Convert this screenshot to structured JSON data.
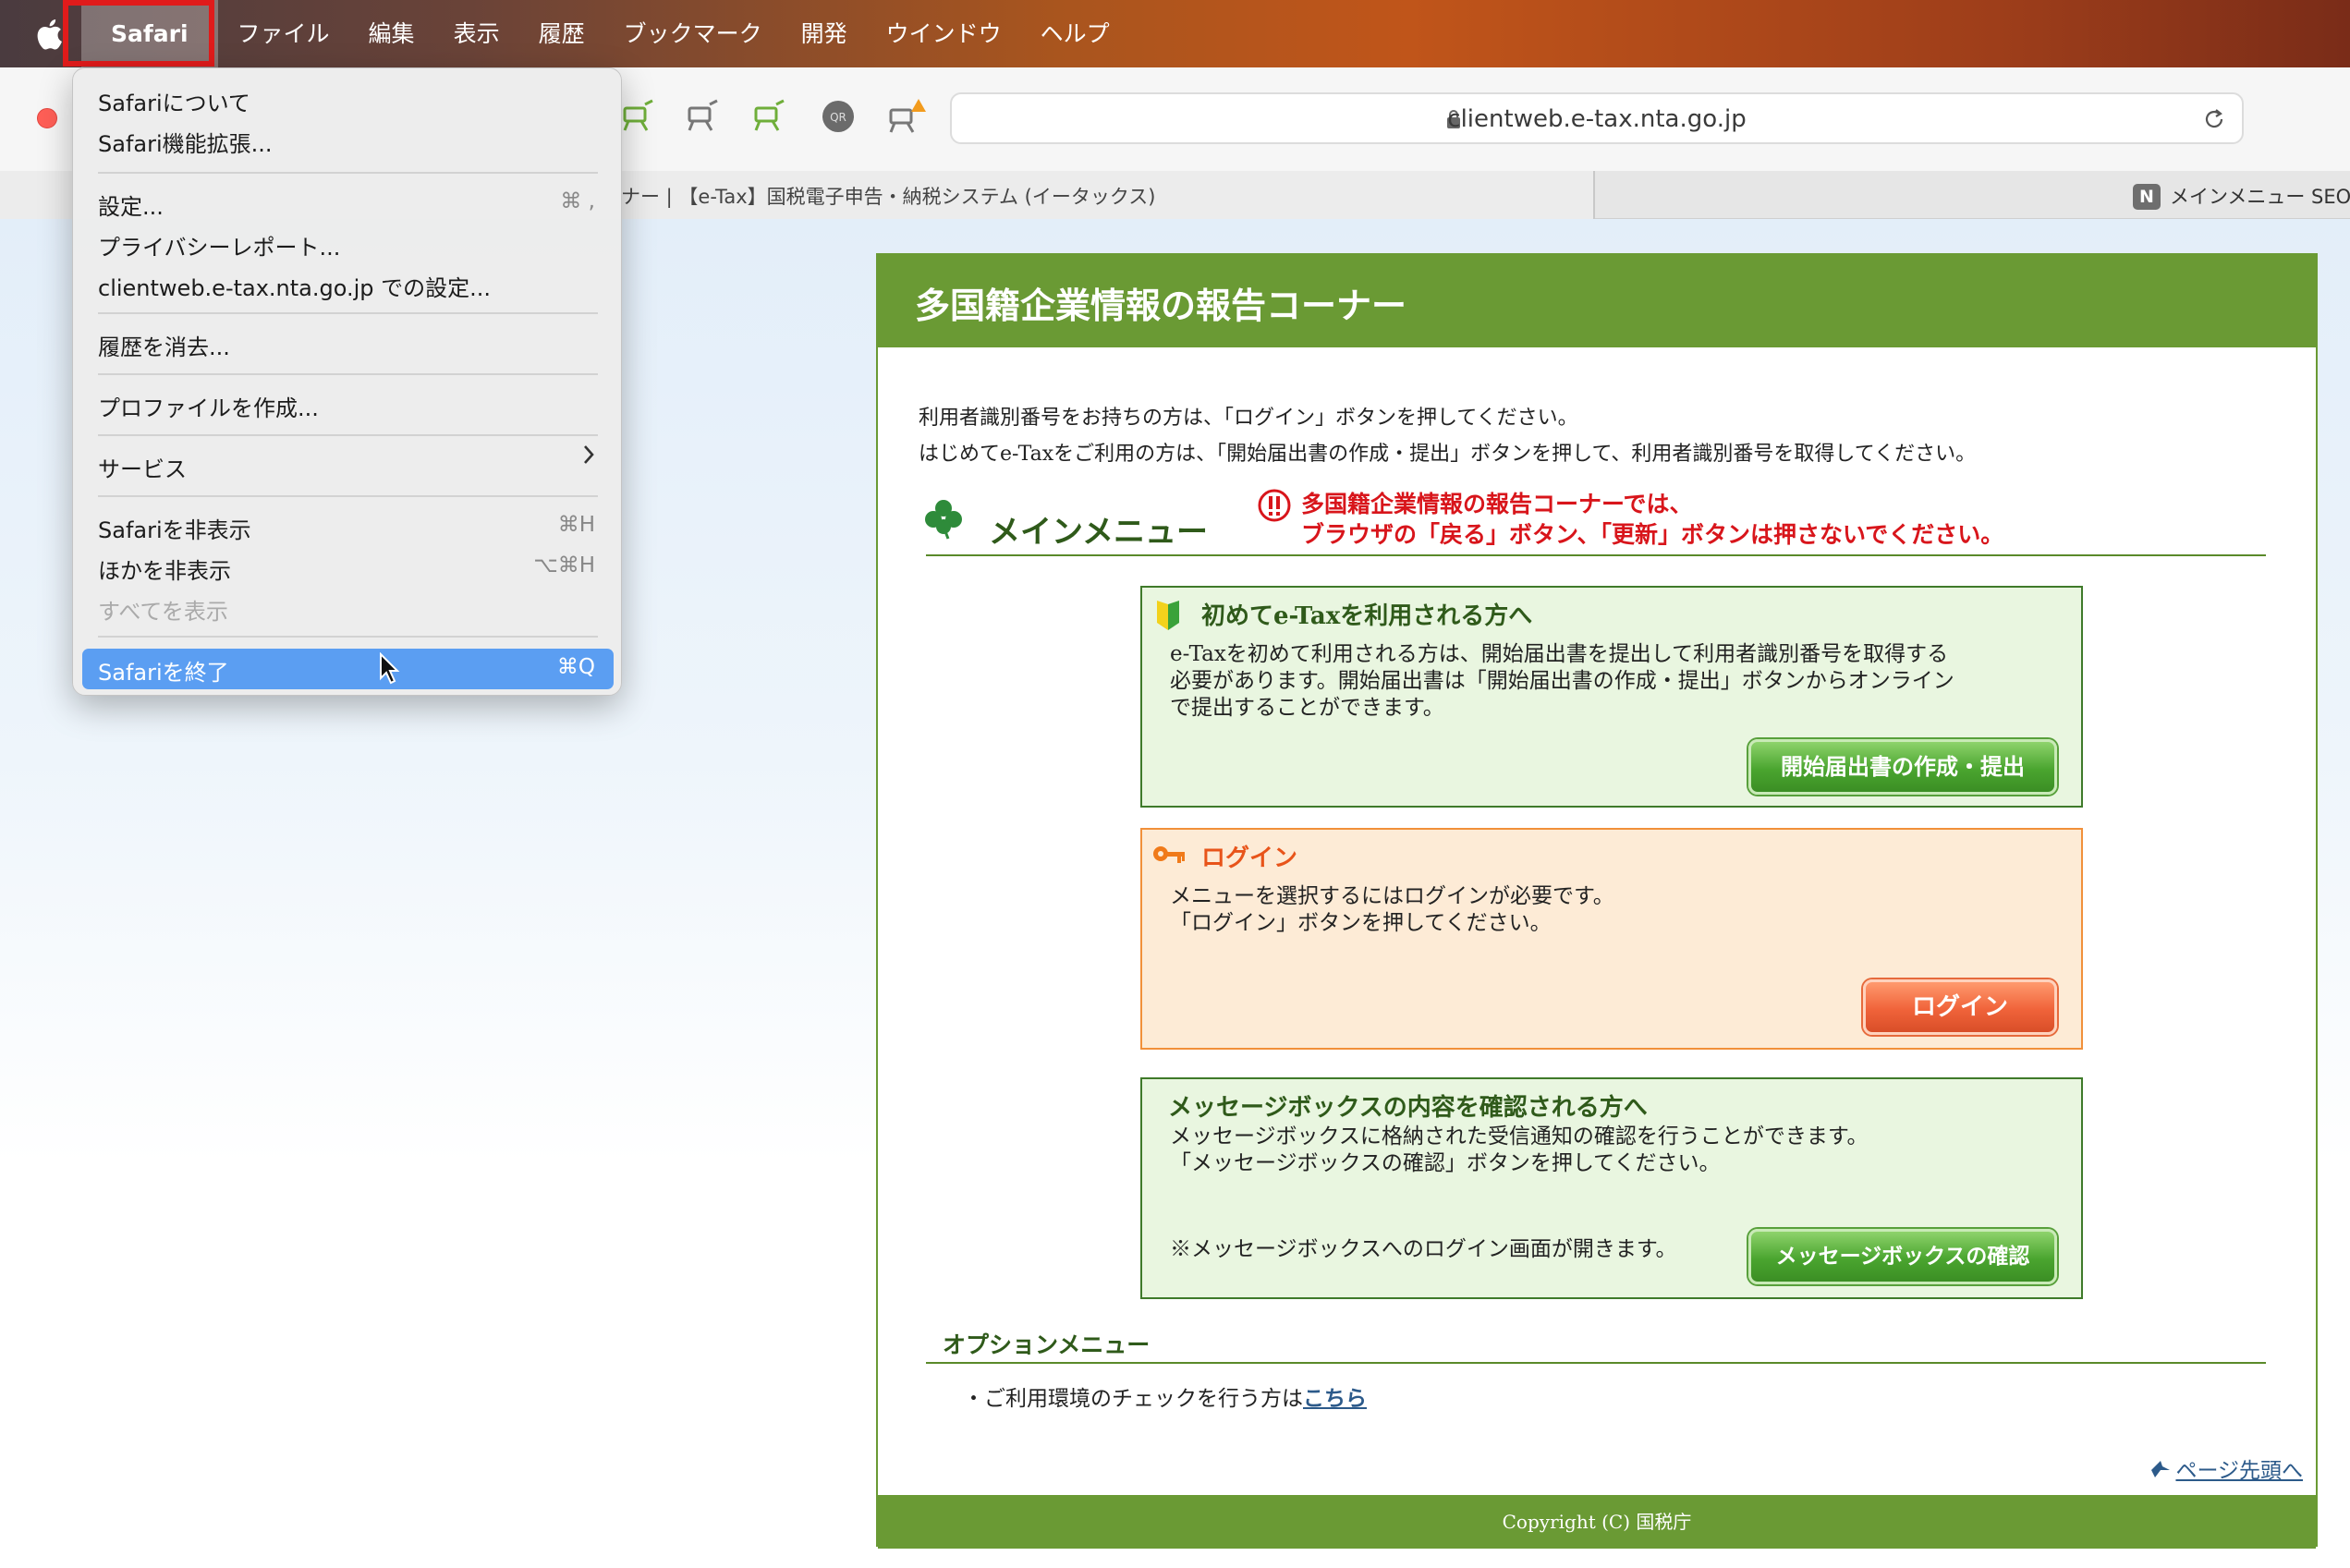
{
  "menubar": {
    "app": "Safari",
    "items": [
      "ファイル",
      "編集",
      "表示",
      "履歴",
      "ブックマーク",
      "開発",
      "ウインドウ",
      "ヘルプ"
    ]
  },
  "browser": {
    "url": "clientweb.e-tax.nta.go.jp",
    "active_tab_label": "ナー |  【e-Tax】国税電子申告・納税システム (イータックス)",
    "second_tab_icon": "N",
    "second_tab_label": "メインメニュー SEO"
  },
  "safari_menu": {
    "about": "Safariについて",
    "extensions": "Safari機能拡張...",
    "settings": "設定...",
    "settings_shortcut": "⌘ ,",
    "privacy_report": "プライバシーレポート...",
    "site_settings": "clientweb.e-tax.nta.go.jp での設定...",
    "clear_history": "履歴を消去...",
    "create_profile": "プロファイルを作成...",
    "services": "サービス",
    "hide_safari": "Safariを非表示",
    "hide_safari_shortcut": "⌘H",
    "hide_others": "ほかを非表示",
    "hide_others_shortcut": "⌥⌘H",
    "show_all": "すべてを表示",
    "quit": "Safariを終了",
    "quit_shortcut": "⌘Q"
  },
  "page": {
    "title": "多国籍企業情報の報告コーナー",
    "intro_line1": "利用者識別番号をお持ちの方は、「ログイン」ボタンを押してください。",
    "intro_line2": "はじめてe-Taxをご利用の方は、「開始届出書の作成・提出」ボタンを押して、利用者識別番号を取得してください。",
    "main_menu_heading": "メインメニュー",
    "warning_line1": "多国籍企業情報の報告コーナーでは、",
    "warning_line2": "ブラウザの「戻る」ボタン、「更新」ボタンは押さないでください。",
    "first_time": {
      "title": "初めてe-Taxを利用される方へ",
      "line1": "e-Taxを初めて利用される方は、開始届出書を提出して利用者識別番号を取得する",
      "line2": "必要があります。開始届出書は「開始届出書の作成・提出」ボタンからオンライン",
      "line3": "で提出することができます。",
      "button": "開始届出書の作成・提出"
    },
    "login": {
      "title": "ログイン",
      "line1": "メニューを選択するにはログインが必要です。",
      "line2": "「ログイン」ボタンを押してください。",
      "button": "ログイン"
    },
    "message_box": {
      "title": "メッセージボックスの内容を確認される方へ",
      "line1": "メッセージボックスに格納された受信通知の確認を行うことができます。",
      "line2": "「メッセージボックスの確認」ボタンを押してください。",
      "note": "※メッセージボックスへのログイン画面が開きます。",
      "button": "メッセージボックスの確認"
    },
    "option_menu_heading": "オプションメニュー",
    "option_item_prefix": "・ご利用環境のチェックを行う方は",
    "option_item_link": "こちら",
    "page_top_link": "ページ先頭へ",
    "footer": "Copyright (C) 国税庁"
  },
  "colors": {
    "accent_green": "#6a9a34",
    "warning_red": "#d8151b",
    "menu_highlight": "#5b9ef2",
    "login_orange": "#f0633a"
  },
  "icons": [
    "apple-icon",
    "lock-icon",
    "reload-icon",
    "clover-icon",
    "warning-icon",
    "beginner-mark-icon",
    "key-icon",
    "chevron-right-icon",
    "cursor-icon",
    "page-top-icon"
  ]
}
